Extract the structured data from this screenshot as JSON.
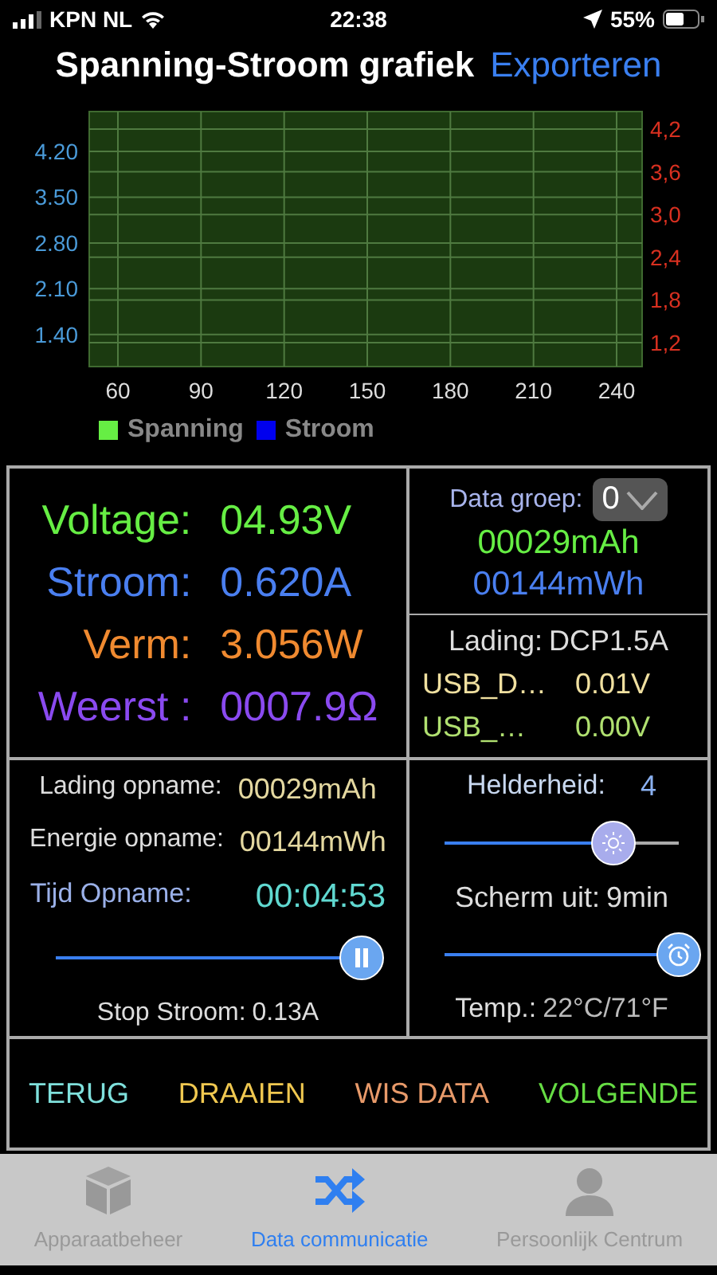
{
  "status_bar": {
    "carrier": "KPN NL",
    "time": "22:38",
    "battery": "55%"
  },
  "header": {
    "title": "Spanning-Stroom grafiek",
    "action": "Exporteren"
  },
  "chart": {
    "chart_data": {
      "type": "line",
      "grid": true,
      "categories": [
        "60",
        "90",
        "120",
        "150",
        "180",
        "210",
        "240"
      ],
      "ylim": [
        0.91,
        4.81
      ],
      "yticks": [
        {
          "value": 1.4,
          "label": "1.40"
        },
        {
          "value": 2.1,
          "label": "2.10"
        },
        {
          "value": 2.8,
          "label": "2.80"
        },
        {
          "value": 3.5,
          "label": "3.50"
        },
        {
          "value": 4.2,
          "label": "4.20"
        }
      ],
      "series": [
        {
          "name": "Spanning",
          "color": "#66ee44",
          "values": [
            null,
            null,
            null,
            null,
            null,
            null,
            null
          ]
        },
        {
          "name": "Stroom",
          "color": "#0000ee",
          "values": [
            null,
            null,
            null,
            null,
            null,
            null,
            null
          ]
        }
      ]
    },
    "right_axis_ticks": [
      "4,2",
      "3,6",
      "3,0",
      "2,4",
      "1,8",
      "1,2"
    ]
  },
  "metrics": [
    {
      "label": "Voltage:",
      "value": "04.93V",
      "color": "#66ee44"
    },
    {
      "label": "Stroom:",
      "value": "0.620A",
      "color": "#4a7ff0"
    },
    {
      "label": "Verm:",
      "value": "3.056W",
      "color": "#f08a30"
    },
    {
      "label": "Weerst :",
      "value": "0007.9Ω",
      "color": "#8a4af0"
    }
  ],
  "data_group": {
    "label": "Data groep:",
    "value": "0",
    "readings": [
      {
        "text": "00029mAh",
        "color": "#66ee44"
      },
      {
        "text": "00144mWh",
        "color": "#4a7ff0"
      }
    ]
  },
  "charge": {
    "label": "Lading:",
    "value": "DCP1.5A",
    "rows": [
      {
        "label": "USB_D…",
        "value": "0.01V",
        "color": "#f0e0a0"
      },
      {
        "label": "USB_…",
        "value": "0.00V",
        "color": "#b0e070"
      }
    ]
  },
  "recording": {
    "rows": [
      {
        "label": "Lading opname:",
        "value": "00029mAh",
        "kind": "plain"
      },
      {
        "label": "Energie opname:",
        "value": "00144mWh",
        "kind": "plain"
      },
      {
        "label": "Tijd Opname:",
        "value": "00:04:53",
        "kind": "time"
      }
    ],
    "slider": {
      "level": 1
    },
    "stop": {
      "label": "Stop Stroom:",
      "value": "0.13A"
    }
  },
  "settings": {
    "brightness": {
      "label": "Helderheid:",
      "value": "4"
    },
    "brightness_slider": {
      "level": 0.72
    },
    "screen_off": {
      "label": "Scherm uit:",
      "value": "9min"
    },
    "screen_off_slider": {
      "level": 1
    },
    "temperature": {
      "label": "Temp.:",
      "value": "22°C/71°F"
    }
  },
  "actions": [
    {
      "label": "TERUG",
      "color": "#7fe0dc"
    },
    {
      "label": "DRAAIEN",
      "color": "#f0c850"
    },
    {
      "label": "WIS DATA",
      "color": "#e89a6a"
    },
    {
      "label": "VOLGENDE",
      "color": "#66dd44"
    }
  ],
  "tabs": [
    {
      "label": "Apparaatbeheer",
      "selected": false
    },
    {
      "label": "Data communicatie",
      "selected": true
    },
    {
      "label": "Persoonlijk Centrum",
      "selected": false
    }
  ]
}
